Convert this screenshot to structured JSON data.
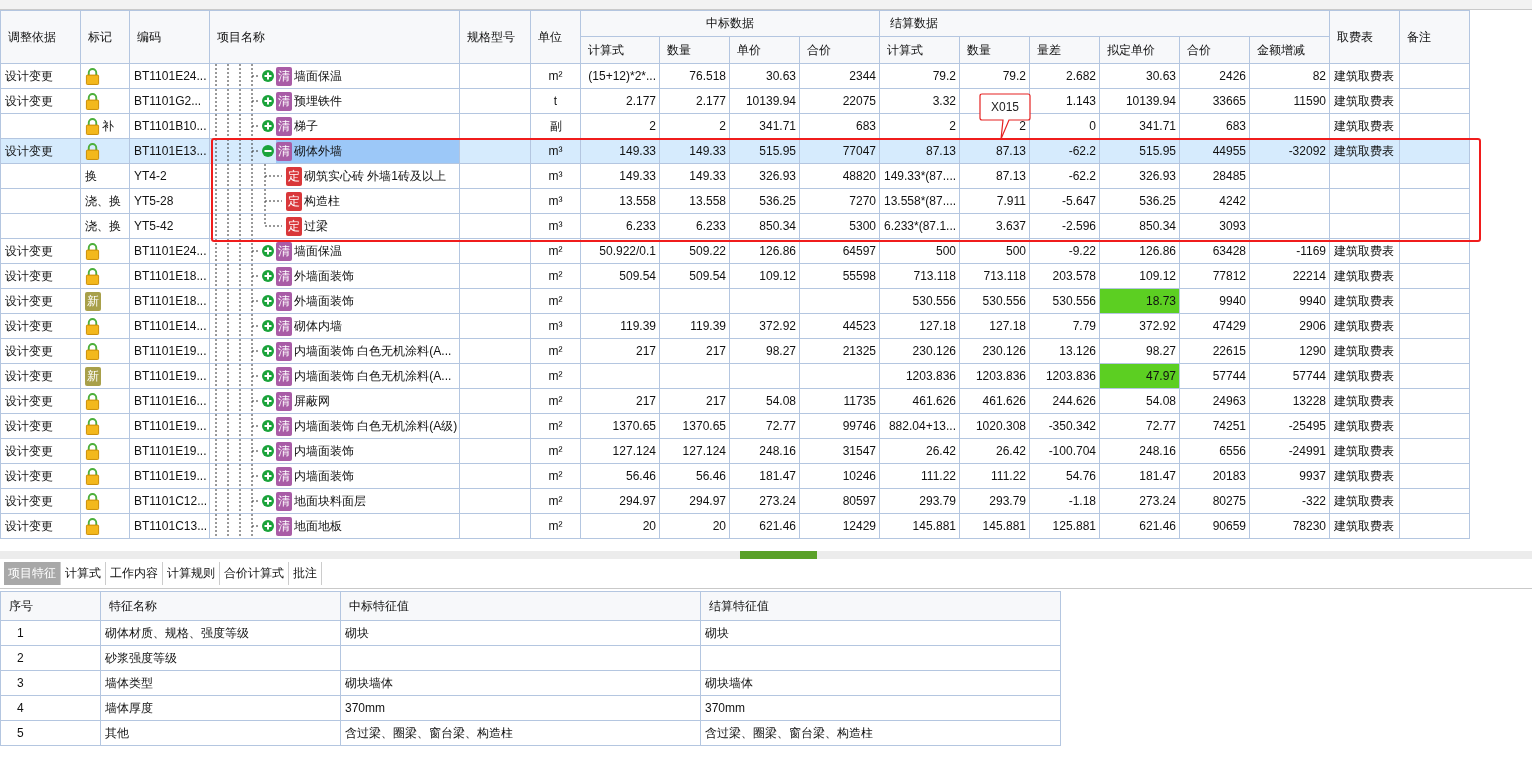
{
  "table": {
    "columns": [
      "调整依据",
      "标记",
      "编码",
      "项目名称",
      "规格型号",
      "单位"
    ],
    "bid_group": {
      "label": "中标数据",
      "columns": [
        "计算式",
        "数量",
        "单价",
        "合价"
      ]
    },
    "settle_group": {
      "label": "结算数据",
      "columns": [
        "计算式",
        "数量",
        "量差",
        "拟定单价",
        "合价",
        "金额增减"
      ]
    },
    "tail_columns": [
      "取费表",
      "备注"
    ],
    "rows": [
      {
        "basis": "设计变更",
        "mark": {
          "kind": "lock"
        },
        "code": "BT1101E24...",
        "tag": {
          "kind": "bill",
          "text": "清"
        },
        "name": "墙面保温",
        "unit": "m²",
        "bid": {
          "calc": "(15+12)*2*...",
          "qty": "76.518",
          "price": "30.63",
          "total": "2344"
        },
        "settle": {
          "calc": "79.2",
          "qty": "79.2",
          "diff": "2.682",
          "price": "30.63",
          "total": "2426",
          "change": "82"
        },
        "fee": "建筑取费表",
        "highlight": false,
        "selected": false,
        "expanded": false
      },
      {
        "basis": "设计变更",
        "mark": {
          "kind": "lock"
        },
        "code": "BT1101G2...",
        "tag": {
          "kind": "bill",
          "text": "清"
        },
        "name": "预埋铁件",
        "unit": "t",
        "bid": {
          "calc": "2.177",
          "qty": "2.177",
          "price": "10139.94",
          "total": "22075"
        },
        "settle": {
          "calc": "3.32",
          "diff": "1.143",
          "price": "10139.94",
          "total": "33665",
          "change": "11590"
        },
        "fee": "建筑取费表",
        "highlight": false,
        "selected": false,
        "expanded": false
      },
      {
        "mark": {
          "kind": "lock",
          "text": "补"
        },
        "code": "BT1101B10...",
        "tag": {
          "kind": "bill",
          "text": "清"
        },
        "name": "梯子",
        "unit": "副",
        "bid": {
          "calc": "2",
          "qty": "2",
          "price": "341.71",
          "total": "683"
        },
        "settle": {
          "calc": "2",
          "qty": "2",
          "diff": "0",
          "price": "341.71",
          "total": "683"
        },
        "fee": "建筑取费表",
        "highlight": false,
        "selected": false,
        "expanded": false
      },
      {
        "basis": "设计变更",
        "mark": {
          "kind": "lock"
        },
        "code": "BT1101E13...",
        "tag": {
          "kind": "bill",
          "text": "清"
        },
        "name": "砌体外墙",
        "unit": "m³",
        "bid": {
          "calc": "149.33",
          "qty": "149.33",
          "price": "515.95",
          "total": "77047"
        },
        "settle": {
          "calc": "87.13",
          "qty": "87.13",
          "diff": "-62.2",
          "price": "515.95",
          "total": "44955",
          "change": "-32092"
        },
        "fee": "建筑取费表",
        "highlight": false,
        "selected": true,
        "expanded": true,
        "children": [
          {
            "mark": {
              "text": "换"
            },
            "code": "YT4-2",
            "tag": {
              "kind": "quota",
              "text": "定"
            },
            "name": "砌筑实心砖 外墙1砖及以上",
            "unit": "m³",
            "bid": {
              "calc": "149.33",
              "qty": "149.33",
              "price": "326.93",
              "total": "48820"
            },
            "settle": {
              "calc": "149.33*(87....",
              "qty": "87.13",
              "diff": "-62.2",
              "price": "326.93",
              "total": "28485"
            },
            "highlight": false,
            "selected": false
          },
          {
            "mark": {
              "text": "浇、换"
            },
            "code": "YT5-28",
            "tag": {
              "kind": "quota",
              "text": "定"
            },
            "name": "构造柱",
            "unit": "m³",
            "bid": {
              "calc": "13.558",
              "qty": "13.558",
              "price": "536.25",
              "total": "7270"
            },
            "settle": {
              "calc": "13.558*(87....",
              "qty": "7.911",
              "diff": "-5.647",
              "price": "536.25",
              "total": "4242"
            },
            "highlight": false,
            "selected": false
          },
          {
            "mark": {
              "text": "浇、换"
            },
            "code": "YT5-42",
            "tag": {
              "kind": "quota",
              "text": "定"
            },
            "name": "过梁",
            "unit": "m³",
            "bid": {
              "calc": "6.233",
              "qty": "6.233",
              "price": "850.34",
              "total": "5300"
            },
            "settle": {
              "calc": "6.233*(87.1...",
              "qty": "3.637",
              "diff": "-2.596",
              "price": "850.34",
              "total": "3093"
            },
            "highlight": false,
            "selected": false
          }
        ]
      },
      {
        "basis": "设计变更",
        "mark": {
          "kind": "lock"
        },
        "code": "BT1101E24...",
        "tag": {
          "kind": "bill",
          "text": "清"
        },
        "name": "墙面保温",
        "unit": "m²",
        "bid": {
          "calc": "50.922/0.1",
          "qty": "509.22",
          "price": "126.86",
          "total": "64597"
        },
        "settle": {
          "calc": "500",
          "qty": "500",
          "diff": "-9.22",
          "price": "126.86",
          "total": "63428",
          "change": "-1169"
        },
        "fee": "建筑取费表",
        "highlight": false,
        "selected": false,
        "expanded": false
      },
      {
        "basis": "设计变更",
        "mark": {
          "kind": "lock"
        },
        "code": "BT1101E18...",
        "tag": {
          "kind": "bill",
          "text": "清"
        },
        "name": "外墙面装饰",
        "unit": "m²",
        "bid": {
          "calc": "509.54",
          "qty": "509.54",
          "price": "109.12",
          "total": "55598"
        },
        "settle": {
          "calc": "713.118",
          "qty": "713.118",
          "diff": "203.578",
          "price": "109.12",
          "total": "77812",
          "change": "22214"
        },
        "fee": "建筑取费表",
        "highlight": false,
        "selected": false,
        "expanded": false
      },
      {
        "basis": "设计变更",
        "mark": {
          "kind": "new",
          "text": "新"
        },
        "code": "BT1101E18...",
        "tag": {
          "kind": "bill",
          "text": "清"
        },
        "name": "外墙面装饰",
        "unit": "m²",
        "settle": {
          "calc": "530.556",
          "qty": "530.556",
          "diff": "530.556",
          "price": "18.73",
          "total": "9940",
          "change": "9940"
        },
        "fee": "建筑取费表",
        "highlight": true,
        "selected": false,
        "expanded": false
      },
      {
        "basis": "设计变更",
        "mark": {
          "kind": "lock"
        },
        "code": "BT1101E14...",
        "tag": {
          "kind": "bill",
          "text": "清"
        },
        "name": "砌体内墙",
        "unit": "m³",
        "bid": {
          "calc": "119.39",
          "qty": "119.39",
          "price": "372.92",
          "total": "44523"
        },
        "settle": {
          "calc": "127.18",
          "qty": "127.18",
          "diff": "7.79",
          "price": "372.92",
          "total": "47429",
          "change": "2906"
        },
        "fee": "建筑取费表",
        "highlight": false,
        "selected": false,
        "expanded": false
      },
      {
        "basis": "设计变更",
        "mark": {
          "kind": "lock"
        },
        "code": "BT1101E19...",
        "tag": {
          "kind": "bill",
          "text": "清"
        },
        "name": "内墙面装饰 白色无机涂料(A...",
        "unit": "m²",
        "bid": {
          "calc": "217",
          "qty": "217",
          "price": "98.27",
          "total": "21325"
        },
        "settle": {
          "calc": "230.126",
          "qty": "230.126",
          "diff": "13.126",
          "price": "98.27",
          "total": "22615",
          "change": "1290"
        },
        "fee": "建筑取费表",
        "highlight": false,
        "selected": false,
        "expanded": false
      },
      {
        "basis": "设计变更",
        "mark": {
          "kind": "new",
          "text": "新"
        },
        "code": "BT1101E19...",
        "tag": {
          "kind": "bill",
          "text": "清"
        },
        "name": "内墙面装饰 白色无机涂料(A...",
        "unit": "m²",
        "settle": {
          "calc": "1203.836",
          "qty": "1203.836",
          "diff": "1203.836",
          "price": "47.97",
          "total": "57744",
          "change": "57744"
        },
        "fee": "建筑取费表",
        "highlight": true,
        "selected": false,
        "expanded": false
      },
      {
        "basis": "设计变更",
        "mark": {
          "kind": "lock"
        },
        "code": "BT1101E16...",
        "tag": {
          "kind": "bill",
          "text": "清"
        },
        "name": "屏蔽网",
        "unit": "m²",
        "bid": {
          "calc": "217",
          "qty": "217",
          "price": "54.08",
          "total": "11735"
        },
        "settle": {
          "calc": "461.626",
          "qty": "461.626",
          "diff": "244.626",
          "price": "54.08",
          "total": "24963",
          "change": "13228"
        },
        "fee": "建筑取费表",
        "highlight": false,
        "selected": false,
        "expanded": false
      },
      {
        "basis": "设计变更",
        "mark": {
          "kind": "lock"
        },
        "code": "BT1101E19...",
        "tag": {
          "kind": "bill",
          "text": "清"
        },
        "name": "内墙面装饰 白色无机涂料(A级)",
        "unit": "m²",
        "bid": {
          "calc": "1370.65",
          "qty": "1370.65",
          "price": "72.77",
          "total": "99746"
        },
        "settle": {
          "calc": "882.04+13...",
          "qty": "1020.308",
          "diff": "-350.342",
          "price": "72.77",
          "total": "74251",
          "change": "-25495"
        },
        "fee": "建筑取费表",
        "highlight": false,
        "selected": false,
        "expanded": false
      },
      {
        "basis": "设计变更",
        "mark": {
          "kind": "lock"
        },
        "code": "BT1101E19...",
        "tag": {
          "kind": "bill",
          "text": "清"
        },
        "name": "内墙面装饰",
        "unit": "m²",
        "bid": {
          "calc": "127.124",
          "qty": "127.124",
          "price": "248.16",
          "total": "31547"
        },
        "settle": {
          "calc": "26.42",
          "qty": "26.42",
          "diff": "-100.704",
          "price": "248.16",
          "total": "6556",
          "change": "-24991"
        },
        "fee": "建筑取费表",
        "highlight": false,
        "selected": false,
        "expanded": false
      },
      {
        "basis": "设计变更",
        "mark": {
          "kind": "lock"
        },
        "code": "BT1101E19...",
        "tag": {
          "kind": "bill",
          "text": "清"
        },
        "name": "内墙面装饰",
        "unit": "m²",
        "bid": {
          "calc": "56.46",
          "qty": "56.46",
          "price": "181.47",
          "total": "10246"
        },
        "settle": {
          "calc": "111.22",
          "qty": "111.22",
          "diff": "54.76",
          "price": "181.47",
          "total": "20183",
          "change": "9937"
        },
        "fee": "建筑取费表",
        "highlight": false,
        "selected": false,
        "expanded": false
      },
      {
        "basis": "设计变更",
        "mark": {
          "kind": "lock"
        },
        "code": "BT1101C12...",
        "tag": {
          "kind": "bill",
          "text": "清"
        },
        "name": "地面块料面层",
        "unit": "m²",
        "bid": {
          "calc": "294.97",
          "qty": "294.97",
          "price": "273.24",
          "total": "80597"
        },
        "settle": {
          "calc": "293.79",
          "qty": "293.79",
          "diff": "-1.18",
          "price": "273.24",
          "total": "80275",
          "change": "-322"
        },
        "fee": "建筑取费表",
        "highlight": false,
        "selected": false,
        "expanded": false
      },
      {
        "basis": "设计变更",
        "mark": {
          "kind": "lock"
        },
        "code": "BT1101C13...",
        "tag": {
          "kind": "bill",
          "text": "清"
        },
        "name": "地面地板",
        "unit": "m²",
        "bid": {
          "calc": "20",
          "qty": "20",
          "price": "621.46",
          "total": "12429"
        },
        "settle": {
          "calc": "145.881",
          "qty": "145.881",
          "diff": "125.881",
          "price": "621.46",
          "total": "90659",
          "change": "78230"
        },
        "fee": "建筑取费表",
        "highlight": false,
        "selected": false,
        "expanded": false
      }
    ]
  },
  "callout": "X015",
  "detail_tabs": [
    {
      "label": "项目特征",
      "selected": true
    },
    {
      "label": "计算式",
      "selected": false
    },
    {
      "label": "工作内容",
      "selected": false
    },
    {
      "label": "计算规则",
      "selected": false
    },
    {
      "label": "合价计算式",
      "selected": false
    },
    {
      "label": "批注",
      "selected": false
    }
  ],
  "features": {
    "columns": [
      "序号",
      "特征名称",
      "中标特征值",
      "结算特征值"
    ],
    "rows": [
      {
        "no": "1",
        "name": "砌体材质、规格、强度等级",
        "bid_value": "砌块",
        "settle_value": "砌块"
      },
      {
        "no": "2",
        "name": "砂浆强度等级"
      },
      {
        "no": "3",
        "name": "墙体类型",
        "bid_value": "砌块墙体",
        "settle_value": "砌块墙体"
      },
      {
        "no": "4",
        "name": "墙体厚度",
        "bid_value": "370mm",
        "settle_value": "370mm"
      },
      {
        "no": "5",
        "name": "其他",
        "bid_value": "含过梁、圈梁、窗台梁、构造柱",
        "settle_value": "含过梁、圈梁、窗台梁、构造柱"
      }
    ]
  }
}
